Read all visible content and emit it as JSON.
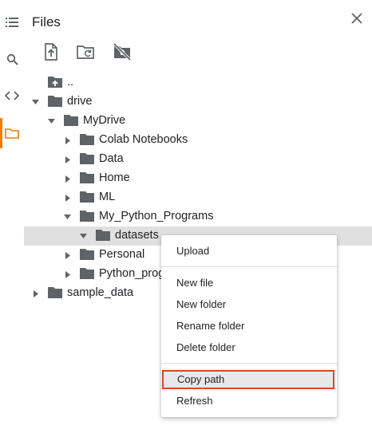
{
  "panel": {
    "title": "Files"
  },
  "rail": {
    "items": [
      {
        "name": "toc-icon"
      },
      {
        "name": "search-icon"
      },
      {
        "name": "code-icon"
      },
      {
        "name": "folder-icon"
      }
    ],
    "active_color": "#f57c00"
  },
  "toolbar": {
    "items": [
      "upload-file-icon",
      "refresh-folder-icon",
      "unmount-drive-icon"
    ]
  },
  "tree": {
    "parent": "..",
    "drive": "drive",
    "mydrive": "MyDrive",
    "colab": "Colab Notebooks",
    "data": "Data",
    "home": "Home",
    "ml": "ML",
    "mypython": "My_Python_Programs",
    "datasets": "datasets",
    "personal": "Personal",
    "python_prog": "Python_prog",
    "sample_data": "sample_data"
  },
  "context_menu": {
    "upload": "Upload",
    "new_file": "New file",
    "new_folder": "New folder",
    "rename_folder": "Rename folder",
    "delete_folder": "Delete folder",
    "copy_path": "Copy path",
    "refresh": "Refresh",
    "highlight_color": "#e0442a"
  }
}
